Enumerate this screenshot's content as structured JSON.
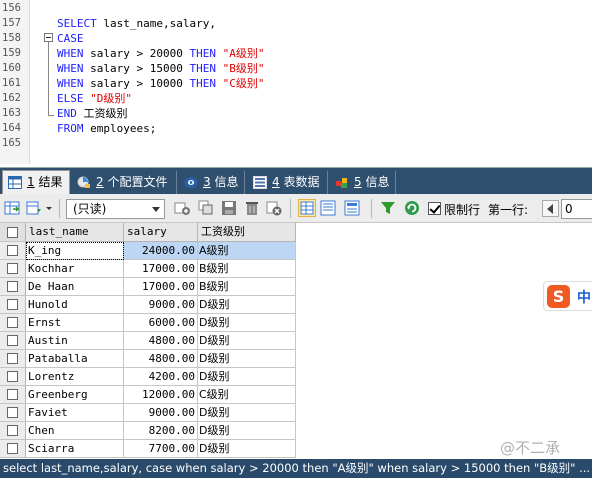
{
  "editor": {
    "lines": [
      {
        "num": "156",
        "parts": []
      },
      {
        "num": "157",
        "parts": [
          {
            "t": "SELECT",
            "c": "kw"
          },
          {
            "t": " last_name,salary,",
            "c": "op"
          }
        ]
      },
      {
        "num": "158",
        "parts": [
          {
            "t": "CASE",
            "c": "kw"
          }
        ]
      },
      {
        "num": "159",
        "parts": [
          {
            "t": "WHEN",
            "c": "kw"
          },
          {
            "t": " salary > 20000 ",
            "c": "op"
          },
          {
            "t": "THEN",
            "c": "kw"
          },
          {
            "t": " \"A级别\"",
            "c": "str"
          }
        ]
      },
      {
        "num": "160",
        "parts": [
          {
            "t": "WHEN",
            "c": "kw"
          },
          {
            "t": " salary > 15000 ",
            "c": "op"
          },
          {
            "t": "THEN",
            "c": "kw"
          },
          {
            "t": " \"B级别\"",
            "c": "str"
          }
        ]
      },
      {
        "num": "161",
        "parts": [
          {
            "t": "WHEN",
            "c": "kw"
          },
          {
            "t": " salary > 10000 ",
            "c": "op"
          },
          {
            "t": "THEN",
            "c": "kw"
          },
          {
            "t": " \"C级别\"",
            "c": "str"
          }
        ]
      },
      {
        "num": "162",
        "parts": [
          {
            "t": "ELSE",
            "c": "kw"
          },
          {
            "t": " \"D级别\"",
            "c": "str"
          }
        ]
      },
      {
        "num": "163",
        "parts": [
          {
            "t": "END",
            "c": "kw"
          },
          {
            "t": " 工资级别",
            "c": "op"
          }
        ]
      },
      {
        "num": "164",
        "parts": [
          {
            "t": "FROM",
            "c": "kw"
          },
          {
            "t": " employees;",
            "c": "op"
          }
        ]
      },
      {
        "num": "165",
        "parts": []
      }
    ]
  },
  "tabs": [
    {
      "num": "1",
      "label": "结果",
      "icon": "results-table-icon",
      "active": true
    },
    {
      "num": "2",
      "label": "个配置文件",
      "icon": "profile-icon",
      "active": false
    },
    {
      "num": "3",
      "label": "信息",
      "icon": "info-icon",
      "active": false
    },
    {
      "num": "4",
      "label": "表数据",
      "icon": "table-data-icon",
      "active": false
    },
    {
      "num": "5",
      "label": "信息",
      "icon": "info-blocks-icon",
      "active": false
    }
  ],
  "toolbar": {
    "mode_select": "(只读)",
    "limit_rows_label": "限制行",
    "limit_rows_checked": true,
    "first_row_label": "第一行:",
    "first_row_value": "0"
  },
  "grid": {
    "columns": [
      "last_name",
      "salary",
      "工资级别"
    ],
    "rows": [
      {
        "name": "K_ing",
        "salary": "24000.00",
        "grade": "A级别"
      },
      {
        "name": "Kochhar",
        "salary": "17000.00",
        "grade": "B级别"
      },
      {
        "name": "De Haan",
        "salary": "17000.00",
        "grade": "B级别"
      },
      {
        "name": "Hunold",
        "salary": "9000.00",
        "grade": "D级别"
      },
      {
        "name": "Ernst",
        "salary": "6000.00",
        "grade": "D级别"
      },
      {
        "name": "Austin",
        "salary": "4800.00",
        "grade": "D级别"
      },
      {
        "name": "Pataballa",
        "salary": "4800.00",
        "grade": "D级别"
      },
      {
        "name": "Lorentz",
        "salary": "4200.00",
        "grade": "D级别"
      },
      {
        "name": "Greenberg",
        "salary": "12000.00",
        "grade": "C级别"
      },
      {
        "name": "Faviet",
        "salary": "9000.00",
        "grade": "D级别"
      },
      {
        "name": "Chen",
        "salary": "8200.00",
        "grade": "D级别"
      },
      {
        "name": "Sciarra",
        "salary": "7700.00",
        "grade": "D级别"
      }
    ],
    "selected_row": 0
  },
  "status": {
    "text": "select last_name,salary, case when salary > 20000 then \"A级别\" when salary > 15000 then \"B级别\" ..."
  },
  "ime": {
    "logo": "S",
    "mode": "中"
  },
  "watermark": "@不二承",
  "colors": {
    "keyword": "#2020ff",
    "string": "#e00000",
    "tab_bar": "#2f4f6f",
    "status_bar": "#294a6a",
    "selection": "#bcd6f4"
  }
}
